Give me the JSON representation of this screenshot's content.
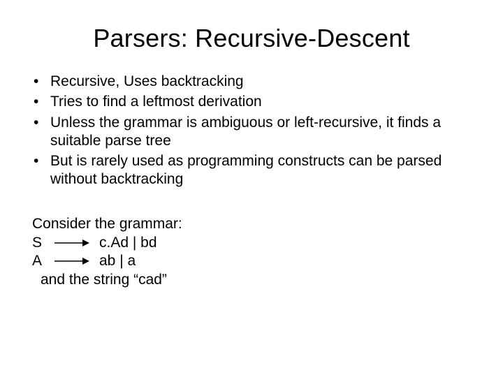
{
  "title": "Parsers: Recursive-Descent",
  "bullets": [
    "Recursive, Uses backtracking",
    "Tries to find a leftmost derivation",
    "Unless the grammar is ambiguous or left-recursive, it finds a suitable parse tree",
    "But is rarely used as programming constructs can be parsed without backtracking"
  ],
  "grammar": {
    "intro": "Consider the grammar:",
    "rules": [
      {
        "lhs": "S",
        "rhs": "c.Ad | bd"
      },
      {
        "lhs": "A",
        "rhs": "ab | a"
      }
    ],
    "footer": "and the string “cad”"
  }
}
